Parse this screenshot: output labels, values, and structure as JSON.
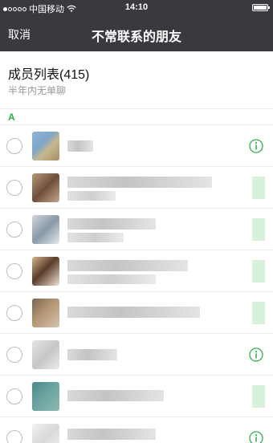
{
  "status_bar": {
    "carrier": "中国移动",
    "time": "14:10"
  },
  "nav": {
    "cancel_label": "取消",
    "title": "不常联系的朋友"
  },
  "members": {
    "title": "成员列表(415)",
    "subtitle": "半年内无单聊"
  },
  "section_letter": "A",
  "colors": {
    "nav_background": "#393a3f",
    "accent_green": "#2bb24c"
  },
  "contacts": [
    {
      "avatar": "blurred-avatar",
      "name_blurred": true,
      "info_icon": "info-icon"
    },
    {
      "avatar": "blurred-avatar",
      "name_blurred": true,
      "info_icon": "blurred"
    },
    {
      "avatar": "blurred-avatar",
      "name_blurred": true,
      "info_icon": "blurred"
    },
    {
      "avatar": "blurred-avatar",
      "name_blurred": true,
      "info_icon": "blurred"
    },
    {
      "avatar": "blurred-avatar",
      "name_blurred": true,
      "info_icon": "blurred"
    },
    {
      "avatar": "blurred-avatar",
      "name_blurred": true,
      "info_icon": "info-icon"
    },
    {
      "avatar": "blurred-avatar",
      "name_blurred": true,
      "info_icon": "blurred"
    },
    {
      "avatar": "blurred-avatar",
      "name_blurred": true,
      "info_icon": "info-icon"
    }
  ]
}
